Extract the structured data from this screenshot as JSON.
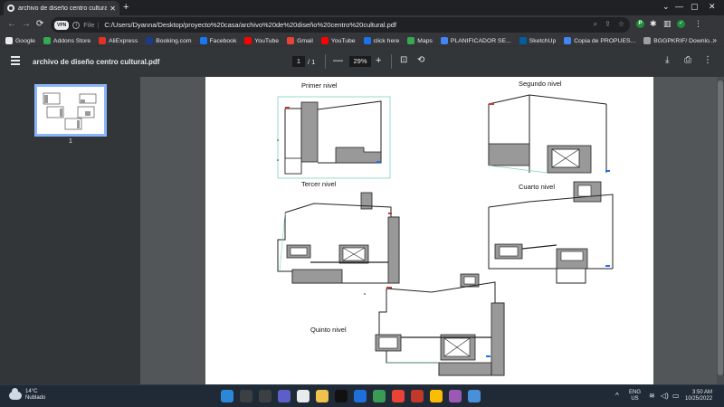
{
  "tab": {
    "title": "archivo de diseño centro cultural.pdf",
    "close": "✕",
    "new": "+"
  },
  "window": {
    "minimize": "—",
    "restore": "▢",
    "close": "✕",
    "caret": "⌄"
  },
  "nav": {
    "back": "←",
    "forward": "→",
    "reload": "⟳"
  },
  "omnibox": {
    "vpn": "VPN",
    "label": "File",
    "url": "C:/Users/Dyanna/Desktop/proyecto%20casa/archivo%20de%20diseño%20centro%20cultural.pdf"
  },
  "bookmarks": [
    {
      "label": "Google",
      "color": "#e8eaed"
    },
    {
      "label": "Addons Store",
      "color": "#34a853"
    },
    {
      "label": "AliExpress",
      "color": "#e43225"
    },
    {
      "label": "Booking.com",
      "color": "#1a3c8a"
    },
    {
      "label": "Facebook",
      "color": "#1877f2"
    },
    {
      "label": "YouTube",
      "color": "#ff0000"
    },
    {
      "label": "Gmail",
      "color": "#ea4335"
    },
    {
      "label": "YouTube",
      "color": "#ff0000"
    },
    {
      "label": "click here",
      "color": "#1a73e8"
    },
    {
      "label": "Maps",
      "color": "#34a853"
    },
    {
      "label": "PLANIFICADOR SE...",
      "color": "#4285f4"
    },
    {
      "label": "SketchUp",
      "color": "#005f9e"
    },
    {
      "label": "Copia de PROPUES...",
      "color": "#4285f4"
    },
    {
      "label": "BGGPKRIF/ Downlo...",
      "color": "#9aa0a6"
    }
  ],
  "bookmarks_more": "»",
  "pdf": {
    "title": "archivo de diseño centro cultural.pdf",
    "page_current": "1",
    "page_total": "/ 1",
    "zoom": "29%",
    "zoom_out": "—",
    "zoom_in": "+",
    "download": "⤓",
    "print": "⎙",
    "more": "⋮",
    "fit": "⊡",
    "rotate": "⟲"
  },
  "thumbnail": {
    "page_number": "1"
  },
  "plans": {
    "primer": "Primer nivel",
    "segundo": "Segundo nivel",
    "tercer": "Tercer nivel",
    "cuarto": "Cuarto nivel",
    "quinto": "Quinto nivel"
  },
  "weather": {
    "temp": "14°C",
    "desc": "Nublado"
  },
  "system": {
    "lang": "ENG",
    "region": "US",
    "time": "3:50 AM",
    "date": "10/25/2022",
    "chevron": "^"
  }
}
